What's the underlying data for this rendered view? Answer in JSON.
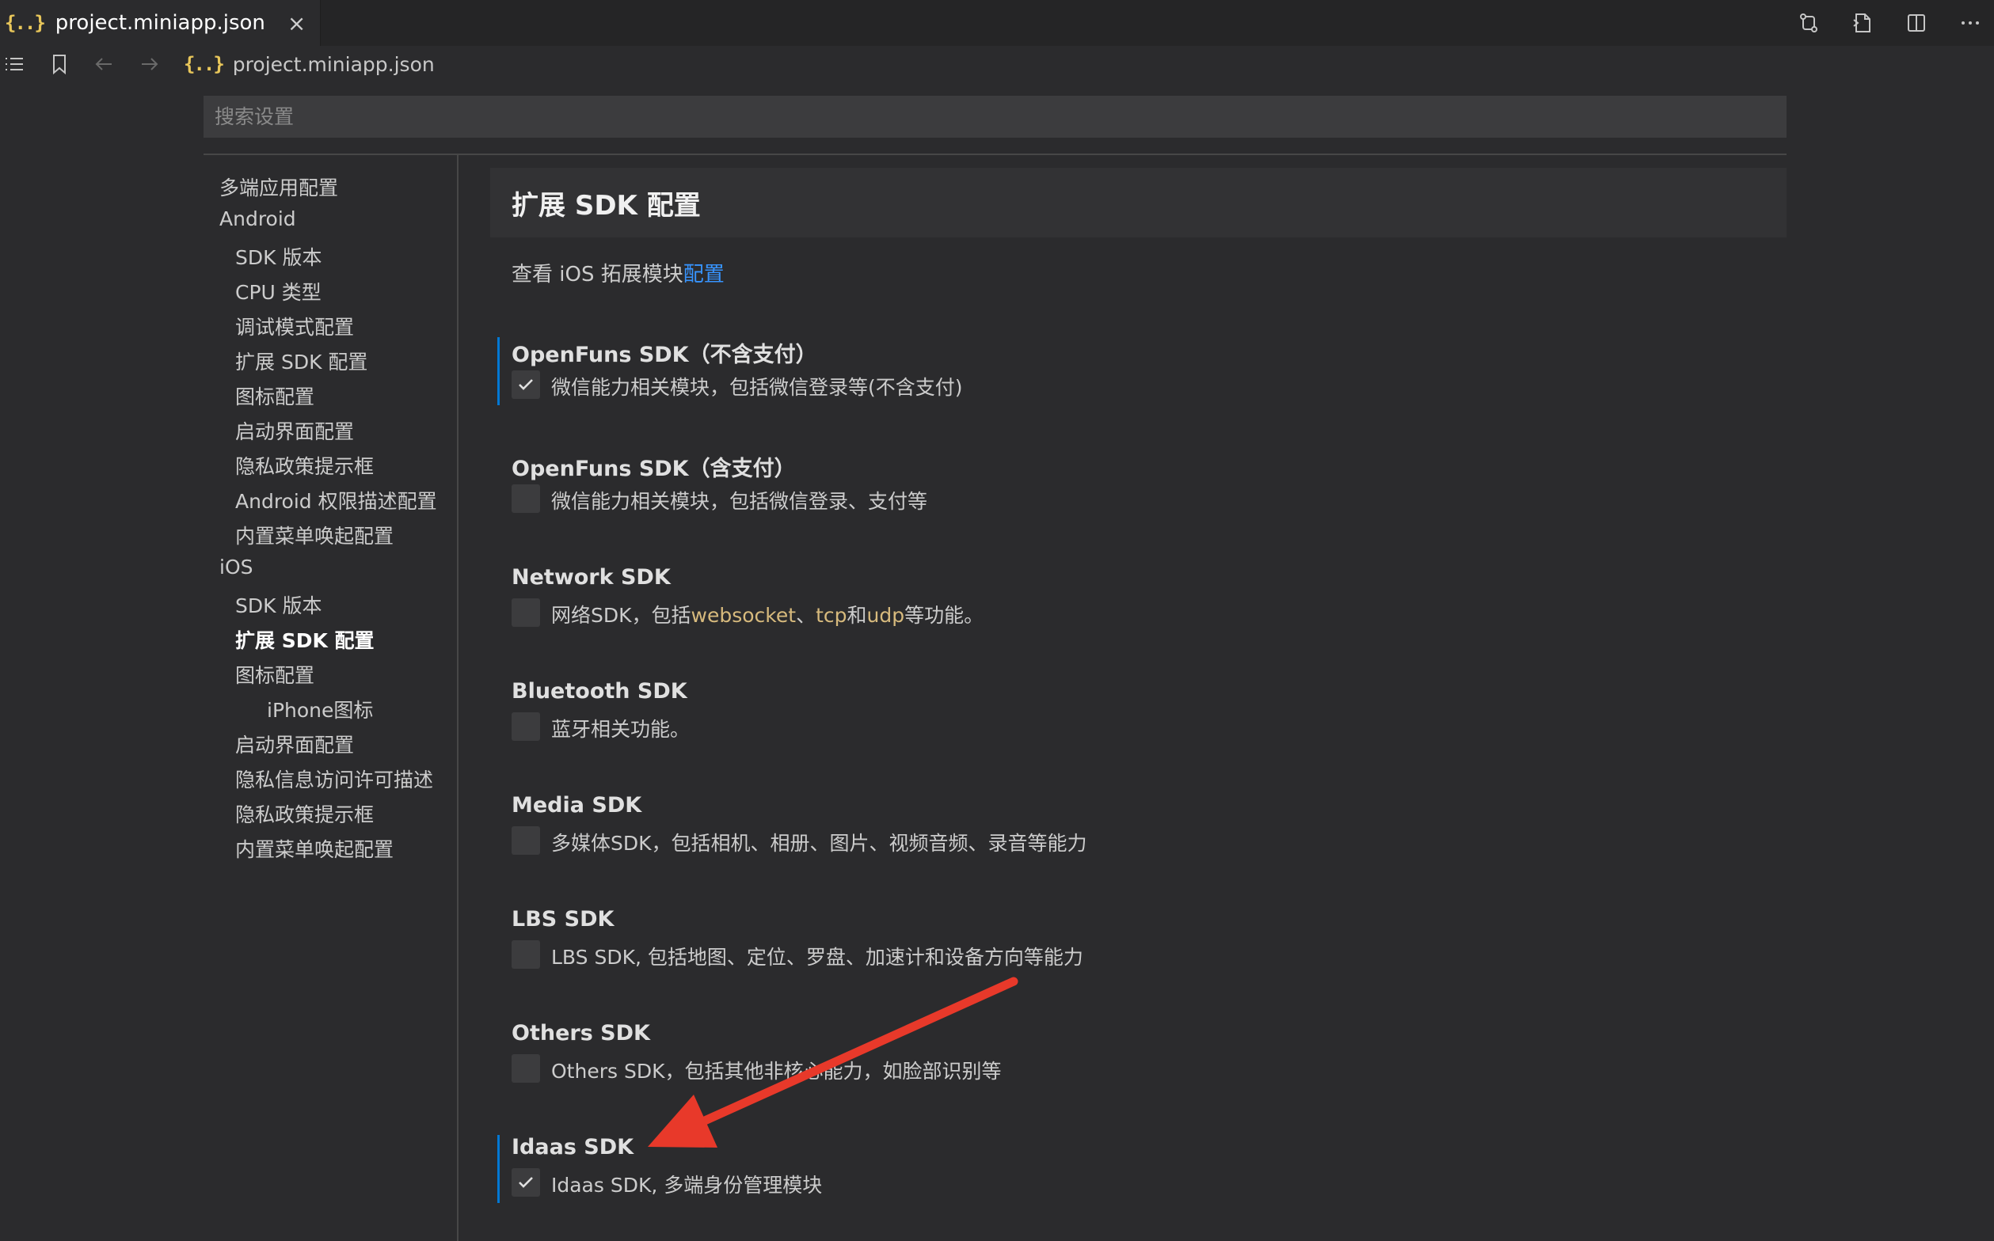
{
  "tab": {
    "icon": "{..}",
    "title": "project.miniapp.json",
    "close": "×"
  },
  "tab_actions": [
    "compare-icon",
    "open-file-icon",
    "split-editor-icon",
    "more-icon"
  ],
  "breadcrumb": {
    "icon": "{..}",
    "file": "project.miniapp.json"
  },
  "search": {
    "placeholder": "搜索设置"
  },
  "toc": [
    {
      "label": "多端应用配置",
      "level": 0
    },
    {
      "label": "Android",
      "level": 0
    },
    {
      "label": "SDK 版本",
      "level": 1
    },
    {
      "label": "CPU 类型",
      "level": 1
    },
    {
      "label": "调试模式配置",
      "level": 1
    },
    {
      "label": "扩展 SDK 配置",
      "level": 1
    },
    {
      "label": "图标配置",
      "level": 1
    },
    {
      "label": "启动界面配置",
      "level": 1
    },
    {
      "label": "隐私政策提示框",
      "level": 1
    },
    {
      "label": "Android 权限描述配置",
      "level": 1
    },
    {
      "label": "内置菜单唤起配置",
      "level": 1
    },
    {
      "label": "iOS",
      "level": 0
    },
    {
      "label": "SDK 版本",
      "level": 1
    },
    {
      "label": "扩展 SDK 配置",
      "level": 1,
      "active": true
    },
    {
      "label": "图标配置",
      "level": 1
    },
    {
      "label": "iPhone图标",
      "level": 2
    },
    {
      "label": "启动界面配置",
      "level": 1
    },
    {
      "label": "隐私信息访问许可描述",
      "level": 1
    },
    {
      "label": "隐私政策提示框",
      "level": 1
    },
    {
      "label": "内置菜单唤起配置",
      "level": 1
    }
  ],
  "section": {
    "title": "扩展 SDK 配置",
    "desc_prefix": "查看 iOS 拓展模块",
    "desc_link": "配置"
  },
  "settings": [
    {
      "title": "OpenFuns SDK（不含支付）",
      "label": "微信能力相关模块，包括微信登录等(不含支付)",
      "checked": true,
      "modified": true
    },
    {
      "title": "OpenFuns SDK（含支付）",
      "label": "微信能力相关模块，包括微信登录、支付等",
      "checked": false
    },
    {
      "title": "Network SDK",
      "label_parts": [
        "网络SDK，包括",
        "websocket",
        "、",
        "tcp",
        "和",
        "udp",
        "等功能。"
      ],
      "checked": false
    },
    {
      "title": "Bluetooth SDK",
      "label": "蓝牙相关功能。",
      "checked": false
    },
    {
      "title": "Media SDK",
      "label": "多媒体SDK，包括相机、相册、图片、视频音频、录音等能力",
      "checked": false
    },
    {
      "title": "LBS SDK",
      "label": "LBS SDK, 包括地图、定位、罗盘、加速计和设备方向等能力",
      "checked": false
    },
    {
      "title": "Others SDK",
      "label": "Others SDK，包括其他非核心能力，如脸部识别等",
      "checked": false
    },
    {
      "title": "Idaas SDK",
      "label": "Idaas SDK, 多端身份管理模块",
      "checked": true,
      "modified": true
    }
  ],
  "annotation": {
    "type": "arrow",
    "color": "#e8392a",
    "points_to": "Idaas SDK"
  }
}
